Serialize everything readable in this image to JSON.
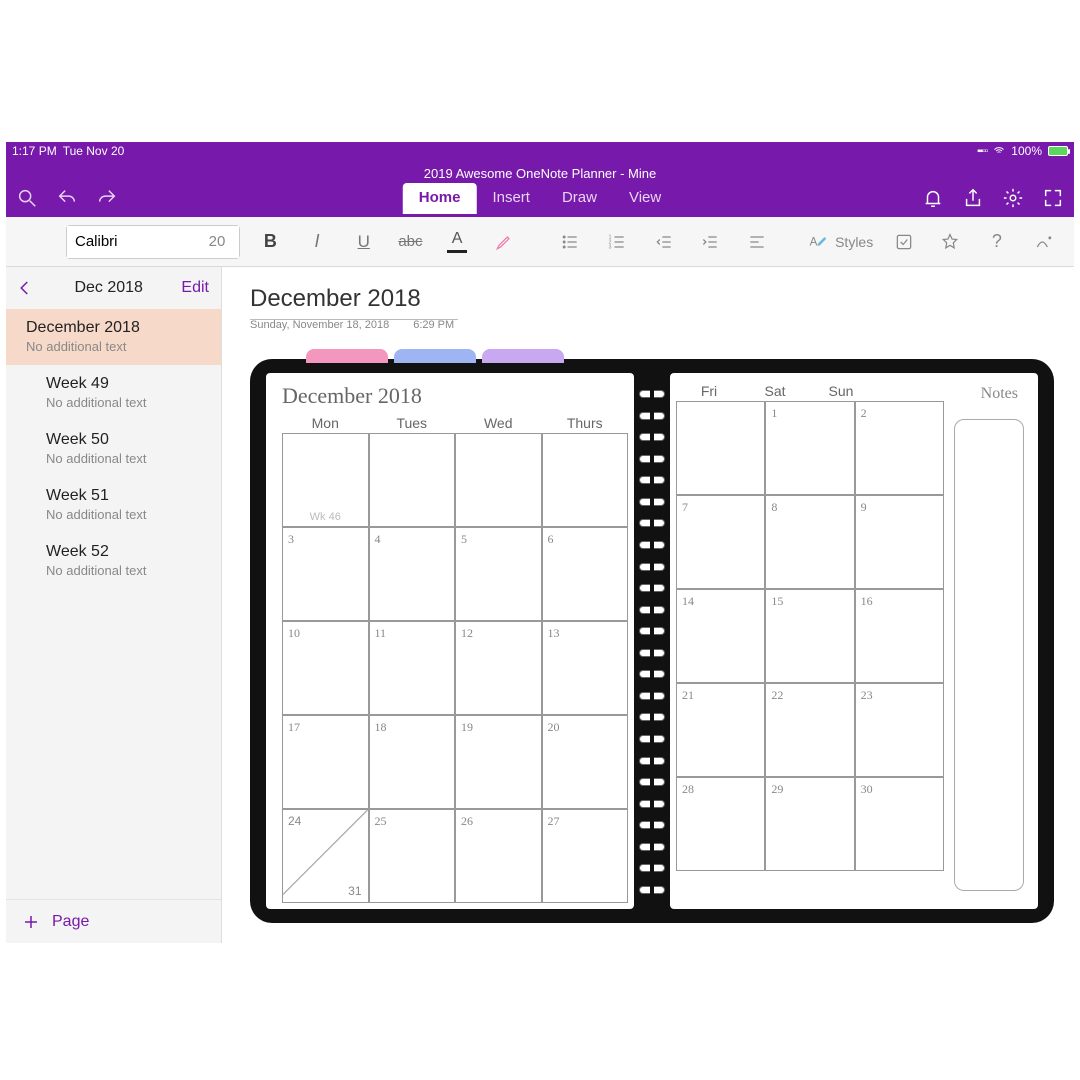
{
  "statusbar": {
    "time": "1:17 PM",
    "date": "Tue Nov 20",
    "battery": "100%"
  },
  "app_title": "2019 Awesome OneNote Planner - Mine",
  "tabs": {
    "home": "Home",
    "insert": "Insert",
    "draw": "Draw",
    "view": "View"
  },
  "ribbon": {
    "font_name": "Calibri",
    "font_size": "20",
    "styles": "Styles"
  },
  "sidebar": {
    "month": "Dec 2018",
    "edit": "Edit",
    "items": [
      {
        "title": "December 2018",
        "sub": "No additional text",
        "selected": true,
        "indent": false
      },
      {
        "title": "Week 49",
        "sub": "No additional text",
        "selected": false,
        "indent": true
      },
      {
        "title": "Week 50",
        "sub": "No additional text",
        "selected": false,
        "indent": true
      },
      {
        "title": "Week 51",
        "sub": "No additional text",
        "selected": false,
        "indent": true
      },
      {
        "title": "Week 52",
        "sub": "No additional text",
        "selected": false,
        "indent": true
      }
    ],
    "add_page": "Page"
  },
  "page": {
    "title": "December 2018",
    "date": "Sunday, November 18, 2018",
    "time": "6:29 PM"
  },
  "planner": {
    "title": "December 2018",
    "notes": "Notes",
    "daysL": [
      "Mon",
      "Tues",
      "Wed",
      "Thurs"
    ],
    "daysR": [
      "Fri",
      "Sat",
      "Sun"
    ],
    "wk_label": "Wk 46",
    "n31": "31",
    "gridL": [
      [
        "",
        "",
        "",
        ""
      ],
      [
        "3",
        "4",
        "5",
        "6"
      ],
      [
        "10",
        "11",
        "12",
        "13"
      ],
      [
        "17",
        "18",
        "19",
        "20"
      ],
      [
        "24",
        "25",
        "26",
        "27"
      ]
    ],
    "gridR": [
      [
        "",
        "1",
        "2"
      ],
      [
        "7",
        "8",
        "9"
      ],
      [
        "14",
        "15",
        "16"
      ],
      [
        "21",
        "22",
        "23"
      ],
      [
        "28",
        "29",
        "30"
      ]
    ]
  }
}
